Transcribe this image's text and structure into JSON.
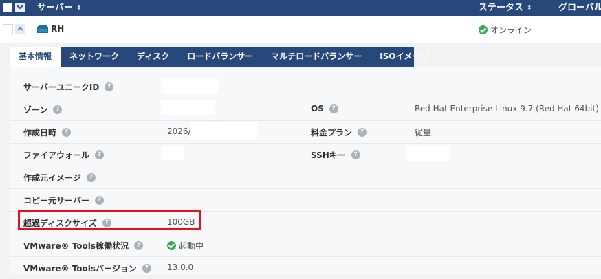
{
  "header": {
    "server_col": "サーバー",
    "status_col": "ステータス",
    "global_col": "グローバル"
  },
  "server_row": {
    "name": "RH",
    "status": "オンライン"
  },
  "tabs": [
    {
      "label": "基本情報"
    },
    {
      "label": "ネットワーク"
    },
    {
      "label": "ディスク"
    },
    {
      "label": "ロードバランサー"
    },
    {
      "label": "マルチロードバランサー"
    },
    {
      "label": "ISOイメージ"
    }
  ],
  "details": {
    "unique_id_label": "サーバーユニークID",
    "zone_label": "ゾーン",
    "created_label": "作成日時",
    "created_value": "2026/",
    "firewall_label": "ファイアウォール",
    "source_image_label": "作成元イメージ",
    "copy_source_label": "コピー元サーバー",
    "excess_disk_label": "超過ディスクサイズ",
    "excess_disk_value": "100GB",
    "tools_status_label": "VMware® Tools稼働状況",
    "tools_status_value": "起動中",
    "tools_version_label": "VMware® Toolsバージョン",
    "tools_version_value": "13.0.0",
    "os_label": "OS",
    "os_value": "Red Hat Enterprise Linux 9.7 (Red Hat 64bit)",
    "plan_label": "料金プラン",
    "plan_value": "従量",
    "ssh_label": "SSHキー"
  },
  "help_glyph": "?",
  "colors": {
    "header_bg": "#27487a",
    "online_green": "#3fa854",
    "highlight_red": "#e3111f"
  }
}
